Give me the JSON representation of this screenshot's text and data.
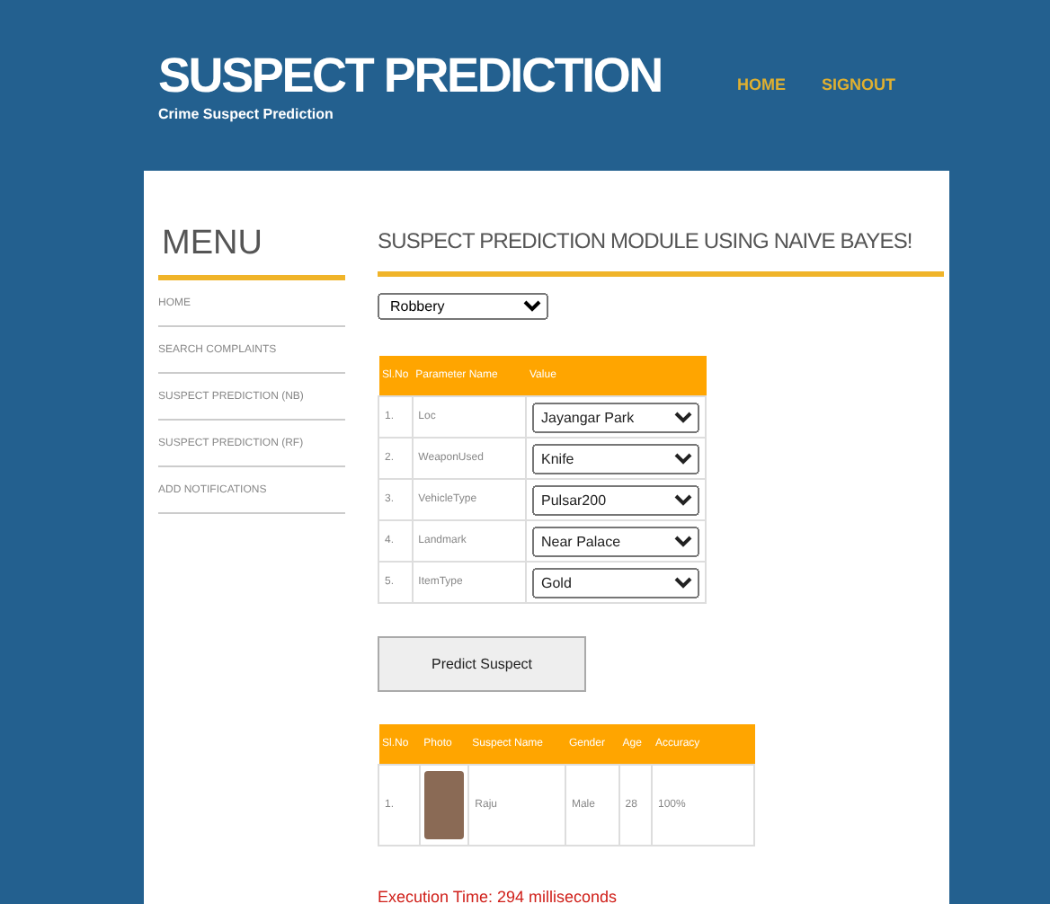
{
  "header": {
    "title": "SUSPECT PREDICTION",
    "subtitle": "Crime Suspect Prediction",
    "nav": [
      {
        "label": "HOME"
      },
      {
        "label": "SIGNOUT"
      }
    ]
  },
  "sidebar": {
    "title": "MENU",
    "items": [
      {
        "label": "HOME"
      },
      {
        "label": "SEARCH COMPLAINTS"
      },
      {
        "label": "SUSPECT PREDICTION (NB)"
      },
      {
        "label": "SUSPECT PREDICTION (RF)"
      },
      {
        "label": "ADD NOTIFICATIONS"
      }
    ]
  },
  "main": {
    "heading": "SUSPECT PREDICTION MODULE USING NAIVE BAYES!",
    "crime_type": "Robbery",
    "parameters": {
      "columns": [
        "Sl.No",
        "Parameter Name",
        "Value"
      ],
      "rows": [
        {
          "no": "1.",
          "name": "Loc",
          "value": "Jayangar Park"
        },
        {
          "no": "2.",
          "name": "WeaponUsed",
          "value": "Knife"
        },
        {
          "no": "3.",
          "name": "VehicleType",
          "value": "Pulsar200"
        },
        {
          "no": "4.",
          "name": "Landmark",
          "value": "Near Palace"
        },
        {
          "no": "5.",
          "name": "ItemType",
          "value": "Gold"
        }
      ]
    },
    "button": "Predict Suspect",
    "results": {
      "columns": [
        "Sl.No",
        "Photo",
        "Suspect Name",
        "Gender",
        "Age",
        "Accuracy"
      ],
      "rows": [
        {
          "no": "1.",
          "name": "Raju",
          "gender": "Male",
          "age": "28",
          "accuracy": "100%"
        }
      ]
    },
    "execution_time": "Execution Time: 294 milliseconds"
  }
}
